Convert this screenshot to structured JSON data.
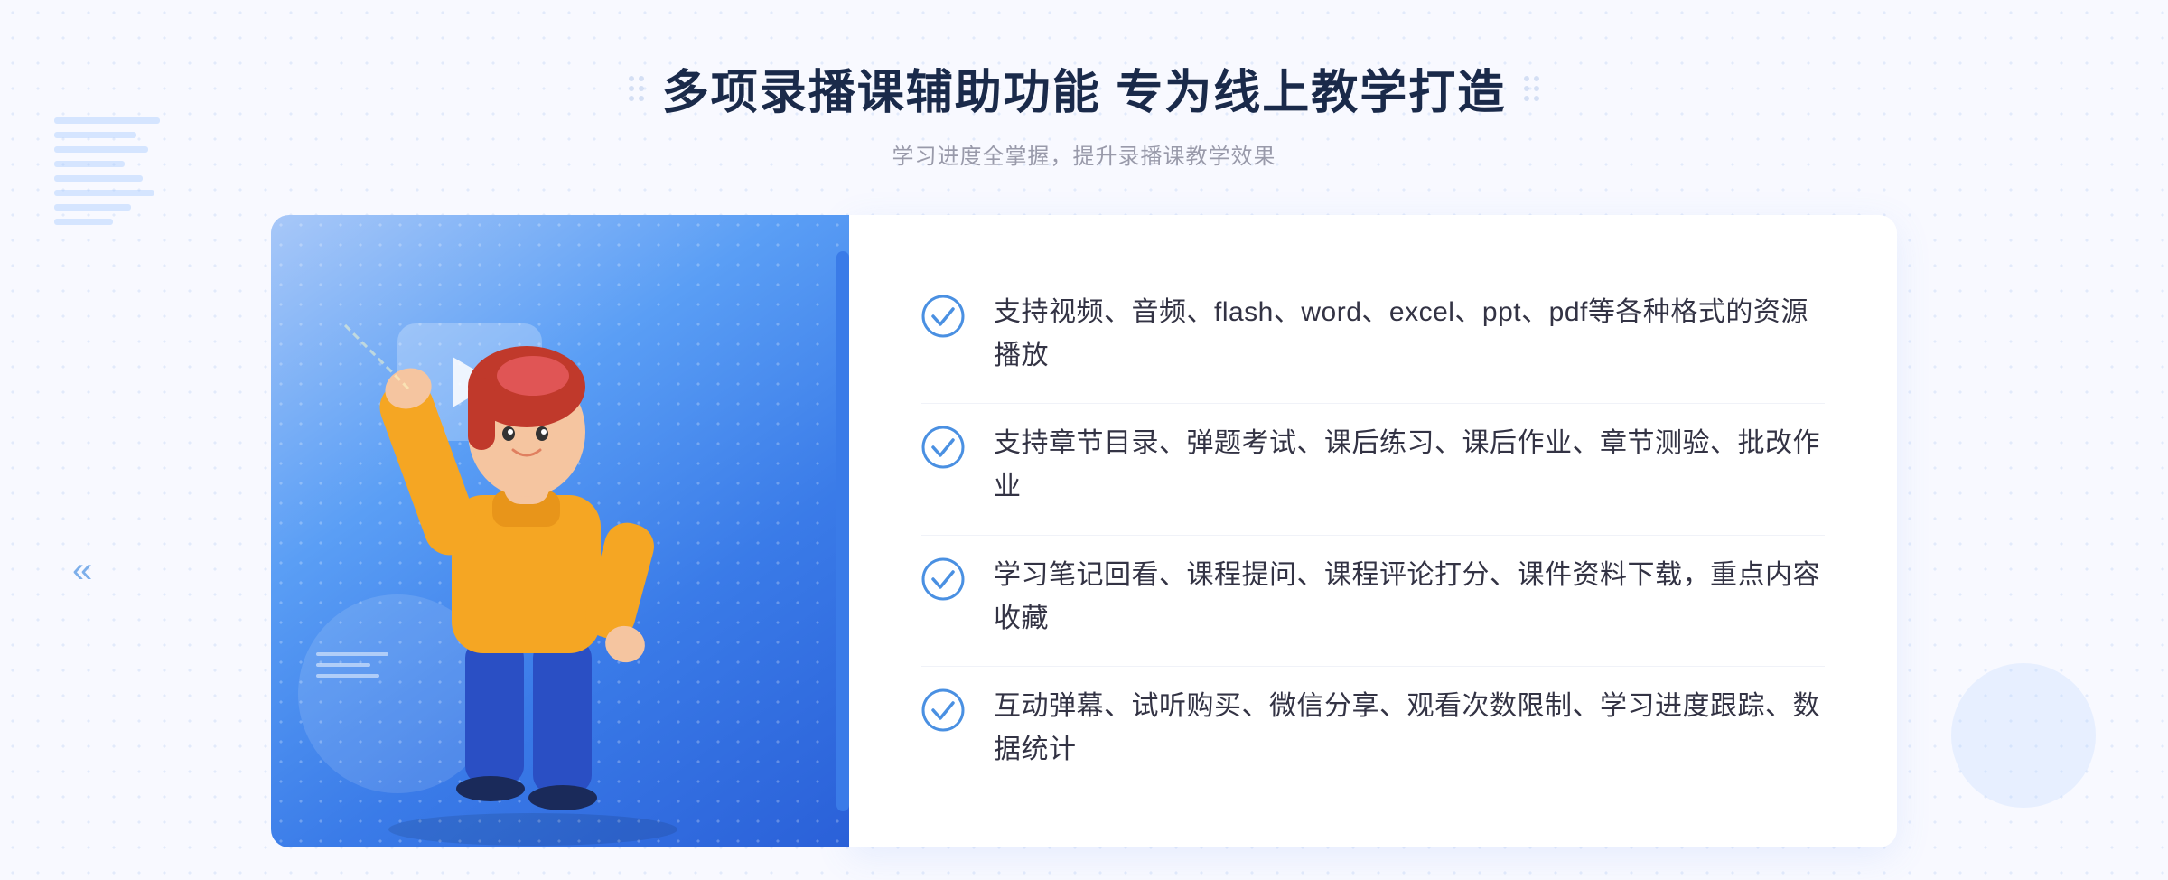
{
  "header": {
    "title": "多项录播课辅助功能 专为线上教学打造",
    "subtitle": "学习进度全掌握，提升录播课教学效果"
  },
  "features": [
    {
      "id": "feature-1",
      "text": "支持视频、音频、flash、word、excel、ppt、pdf等各种格式的资源播放"
    },
    {
      "id": "feature-2",
      "text": "支持章节目录、弹题考试、课后练习、课后作业、章节测验、批改作业"
    },
    {
      "id": "feature-3",
      "text": "学习笔记回看、课程提问、课程评论打分、课件资料下载，重点内容收藏"
    },
    {
      "id": "feature-4",
      "text": "互动弹幕、试听购买、微信分享、观看次数限制、学习进度跟踪、数据统计"
    }
  ],
  "icons": {
    "check_color": "#4a90e2",
    "title_dot_color": "#aac0e8"
  }
}
